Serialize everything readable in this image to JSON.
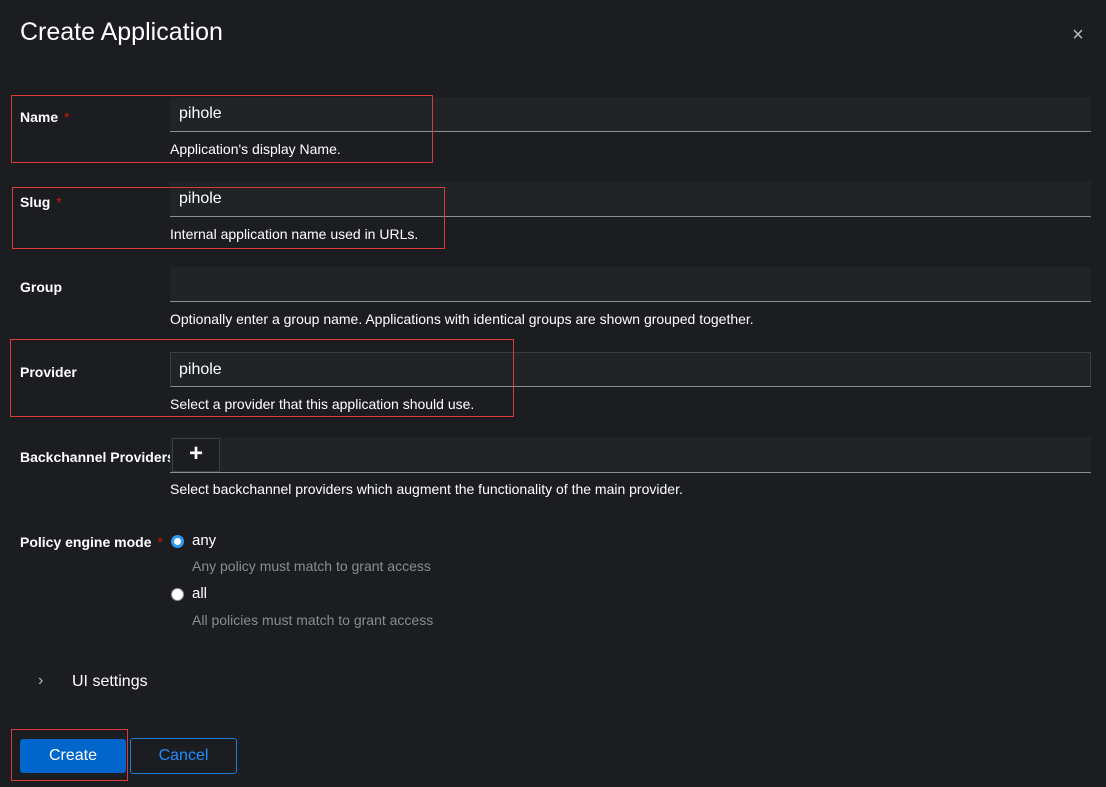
{
  "modal": {
    "title": "Create Application",
    "close_symbol": "×",
    "close_icon": "close-icon"
  },
  "form": {
    "name": {
      "label": "Name",
      "required_mark": "*",
      "value": "pihole",
      "helper": "Application's display Name."
    },
    "slug": {
      "label": "Slug",
      "required_mark": "*",
      "value": "pihole",
      "helper": "Internal application name used in URLs."
    },
    "group": {
      "label": "Group",
      "value": "",
      "helper": "Optionally enter a group name. Applications with identical groups are shown grouped together."
    },
    "provider": {
      "label": "Provider",
      "value": "pihole",
      "helper": "Select a provider that this application should use."
    },
    "backchannel": {
      "label": "Backchannel Providers",
      "add_symbol": "+",
      "add_icon": "plus-icon",
      "helper": "Select backchannel providers which augment the functionality of the main provider."
    },
    "policy_engine_mode": {
      "label": "Policy engine mode",
      "required_mark": "*",
      "options": [
        {
          "label": "any",
          "description": "Any policy must match to grant access",
          "checked": true
        },
        {
          "label": "all",
          "description": "All policies must match to grant access",
          "checked": false
        }
      ]
    },
    "ui_settings": {
      "label": "UI settings",
      "chevron_symbol": "›",
      "icon": "chevron-right-icon",
      "expanded": false
    }
  },
  "actions": {
    "create_label": "Create",
    "cancel_label": "Cancel"
  },
  "colors": {
    "background": "#1b1d21",
    "input_background": "#212427",
    "primary": "#0066cc",
    "link": "#1f8fff",
    "required": "#c9190b",
    "highlight": "#d93a3a",
    "muted_text": "#8a8d90"
  }
}
